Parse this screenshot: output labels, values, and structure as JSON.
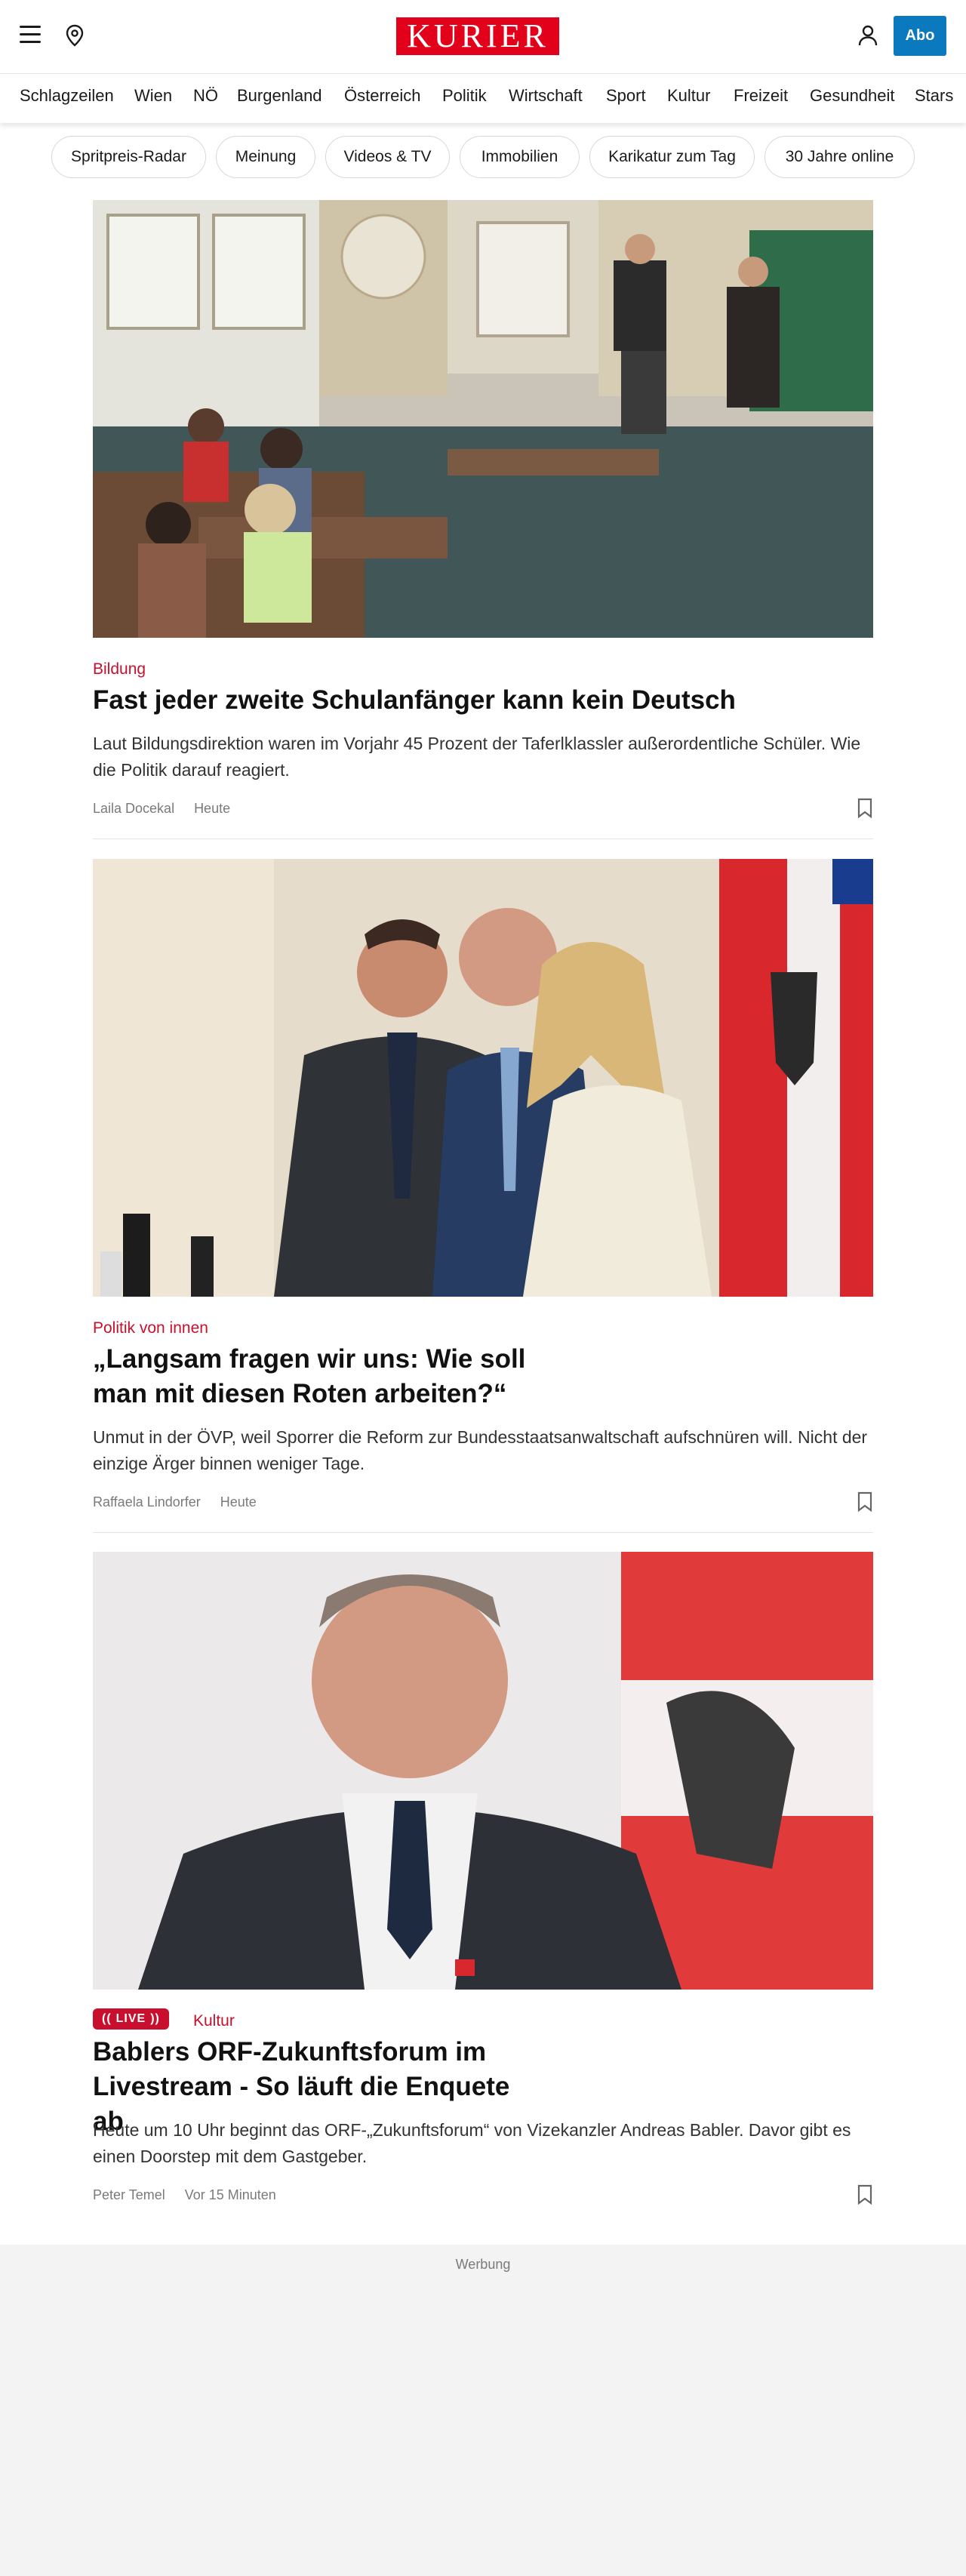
{
  "header": {
    "brand": "KURIER",
    "abo_label": "Abo",
    "brand_color": "#e2001a",
    "abo_color": "#0a79be"
  },
  "nav": {
    "items": [
      {
        "label": "Schlagzeilen"
      },
      {
        "label": "Wien"
      },
      {
        "label": "NÖ"
      },
      {
        "label": "Burgenland"
      },
      {
        "label": "Österreich"
      },
      {
        "label": "Politik"
      },
      {
        "label": "Wirtschaft"
      },
      {
        "label": "Sport"
      },
      {
        "label": "Kultur"
      },
      {
        "label": "Freizeit"
      },
      {
        "label": "Gesundheit"
      },
      {
        "label": "Stars"
      }
    ]
  },
  "chips": [
    {
      "label": "Spritpreis-Radar"
    },
    {
      "label": "Meinung"
    },
    {
      "label": "Videos & TV"
    },
    {
      "label": "Immobilien"
    },
    {
      "label": "Karikatur zum Tag"
    },
    {
      "label": "30 Jahre online"
    }
  ],
  "articles": [
    {
      "kicker": "Bildung",
      "title": "Fast jeder zweite Schulanfänger kann kein Deutsch",
      "teaser": "Laut Bildungsdirektion waren im Vorjahr 45 Prozent der Taferlklassler außerordentliche Schüler. Wie die Politik darauf reagiert.",
      "author": "Laila Docekal",
      "time": "Heute"
    },
    {
      "kicker": "Politik von innen",
      "title": "„Langsam fragen wir uns: Wie soll man mit diesen Roten arbeiten?“",
      "teaser": "Unmut in der ÖVP, weil Sporrer die Reform zur Bundesstaatsanwaltschaft aufschnüren will. Nicht der einzige Ärger binnen weniger Tage.",
      "author": "Raffaela Lindorfer",
      "time": "Heute"
    },
    {
      "live_label": "LIVE",
      "kicker": "Kultur",
      "title": "Bablers ORF-Zukunftsforum im Livestream - So läuft die Enquete ab",
      "teaser": "Heute um 10 Uhr beginnt das ORF-„Zukunftsforum“ von Vizekanzler Andreas Babler. Davor gibt es einen Doorstep mit dem Gastgeber.",
      "author": "Peter Temel",
      "time": "Vor 15 Minuten"
    }
  ],
  "ad": {
    "label": "Werbung"
  }
}
